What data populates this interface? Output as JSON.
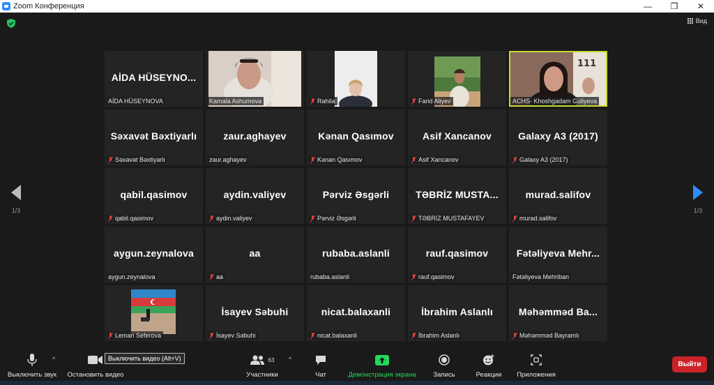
{
  "window": {
    "title": "Zoom Конференция",
    "controls": [
      "minimize",
      "maximize",
      "close"
    ]
  },
  "view_button": {
    "label": "Вид"
  },
  "pagination": {
    "left": "1/3",
    "right": "1/3"
  },
  "participants": [
    {
      "big": "AİDA  HÜSEYNO...",
      "label": "AİDA HÜSEYNOVA",
      "muted": false,
      "photo": null
    },
    {
      "big": "",
      "label": "Kamala Ashumova",
      "muted": false,
      "photo": "woman-headscarf"
    },
    {
      "big": "",
      "label": "Rahila",
      "muted": true,
      "photo": "woman-blond"
    },
    {
      "big": "",
      "label": "Farid Aliyev",
      "muted": true,
      "photo": "man-outdoor"
    },
    {
      "big": "",
      "label": "ACHS- Khoshgadam Guliyeva",
      "muted": false,
      "photo": "woman-dark-hair",
      "active": true
    },
    {
      "big": "Səxavət Bəxtiyarlı",
      "label": "Səxavət Bəxtiyarlı",
      "muted": true
    },
    {
      "big": "zaur.aghayev",
      "label": "zaur.aghayev",
      "muted": false
    },
    {
      "big": "Kənan Qasımov",
      "label": "Kənan Qasımov",
      "muted": true
    },
    {
      "big": "Asif Xancanov",
      "label": "Asif Xancanov",
      "muted": true
    },
    {
      "big": "Galaxy A3 (2017)",
      "label": "Galaxy A3 (2017)",
      "muted": true
    },
    {
      "big": "qabil.qasimov",
      "label": "qabil.qasimov",
      "muted": true
    },
    {
      "big": "aydin.valiyev",
      "label": "aydin.valiyev",
      "muted": true
    },
    {
      "big": "Pərviz Əsgərli",
      "label": "Pərviz Əsgərli",
      "muted": true
    },
    {
      "big": "TƏBRİZ  MUSTA...",
      "label": "TƏBRİZ MUSTAFAYEV",
      "muted": true
    },
    {
      "big": "murad.salifov",
      "label": "murad.salifov",
      "muted": true
    },
    {
      "big": "aygun.zeynalova",
      "label": "aygun.zeynalova",
      "muted": false
    },
    {
      "big": "aa",
      "label": "aa",
      "muted": true
    },
    {
      "big": "rubaba.aslanli",
      "label": "rubaba.aslanli",
      "muted": false
    },
    {
      "big": "rauf.qasimov",
      "label": "rauf.qasimov",
      "muted": true
    },
    {
      "big": "Fətəliyeva  Mehr...",
      "label": "Fətəliyeva Mehriban",
      "muted": false
    },
    {
      "big": "",
      "label": "Leman Seferova",
      "muted": true,
      "photo": "flag"
    },
    {
      "big": "İsayev Səbuhi",
      "label": "İsayev Səbuhi",
      "muted": true
    },
    {
      "big": "nicat.balaxanli",
      "label": "nicat.balaxanli",
      "muted": true
    },
    {
      "big": "İbrahim Aslanlı",
      "label": "İbrahim Aslanlı",
      "muted": true
    },
    {
      "big": "Məhəmməd  Ba...",
      "label": "Məhəmməd Bayramlı",
      "muted": true
    }
  ],
  "toolbar": {
    "mute_label": "Выключить звук",
    "video_label": "Остановить видео",
    "participants_label": "Участники",
    "participants_count": "63",
    "chat_label": "Чат",
    "share_label": "Демонстрация экрана",
    "record_label": "Запись",
    "reactions_label": "Реакции",
    "apps_label": "Приложения",
    "leave_label": "Выйти",
    "tooltip": "Выключить видео (Alt+V)"
  },
  "colors": {
    "accent": "#2d8cff",
    "active_border": "#c8d933",
    "share_green": "#23d959",
    "leave_red": "#cc2229",
    "muted_red": "#e04040"
  }
}
